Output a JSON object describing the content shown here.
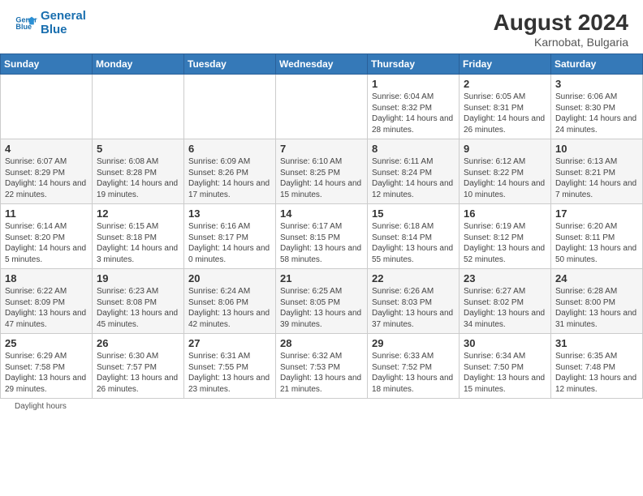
{
  "header": {
    "logo_line1": "General",
    "logo_line2": "Blue",
    "month_year": "August 2024",
    "location": "Karnobat, Bulgaria"
  },
  "days_of_week": [
    "Sunday",
    "Monday",
    "Tuesday",
    "Wednesday",
    "Thursday",
    "Friday",
    "Saturday"
  ],
  "weeks": [
    [
      {
        "day": "",
        "sunrise": "",
        "sunset": "",
        "daylight": ""
      },
      {
        "day": "",
        "sunrise": "",
        "sunset": "",
        "daylight": ""
      },
      {
        "day": "",
        "sunrise": "",
        "sunset": "",
        "daylight": ""
      },
      {
        "day": "",
        "sunrise": "",
        "sunset": "",
        "daylight": ""
      },
      {
        "day": "1",
        "sunrise": "Sunrise: 6:04 AM",
        "sunset": "Sunset: 8:32 PM",
        "daylight": "Daylight: 14 hours and 28 minutes."
      },
      {
        "day": "2",
        "sunrise": "Sunrise: 6:05 AM",
        "sunset": "Sunset: 8:31 PM",
        "daylight": "Daylight: 14 hours and 26 minutes."
      },
      {
        "day": "3",
        "sunrise": "Sunrise: 6:06 AM",
        "sunset": "Sunset: 8:30 PM",
        "daylight": "Daylight: 14 hours and 24 minutes."
      }
    ],
    [
      {
        "day": "4",
        "sunrise": "Sunrise: 6:07 AM",
        "sunset": "Sunset: 8:29 PM",
        "daylight": "Daylight: 14 hours and 22 minutes."
      },
      {
        "day": "5",
        "sunrise": "Sunrise: 6:08 AM",
        "sunset": "Sunset: 8:28 PM",
        "daylight": "Daylight: 14 hours and 19 minutes."
      },
      {
        "day": "6",
        "sunrise": "Sunrise: 6:09 AM",
        "sunset": "Sunset: 8:26 PM",
        "daylight": "Daylight: 14 hours and 17 minutes."
      },
      {
        "day": "7",
        "sunrise": "Sunrise: 6:10 AM",
        "sunset": "Sunset: 8:25 PM",
        "daylight": "Daylight: 14 hours and 15 minutes."
      },
      {
        "day": "8",
        "sunrise": "Sunrise: 6:11 AM",
        "sunset": "Sunset: 8:24 PM",
        "daylight": "Daylight: 14 hours and 12 minutes."
      },
      {
        "day": "9",
        "sunrise": "Sunrise: 6:12 AM",
        "sunset": "Sunset: 8:22 PM",
        "daylight": "Daylight: 14 hours and 10 minutes."
      },
      {
        "day": "10",
        "sunrise": "Sunrise: 6:13 AM",
        "sunset": "Sunset: 8:21 PM",
        "daylight": "Daylight: 14 hours and 7 minutes."
      }
    ],
    [
      {
        "day": "11",
        "sunrise": "Sunrise: 6:14 AM",
        "sunset": "Sunset: 8:20 PM",
        "daylight": "Daylight: 14 hours and 5 minutes."
      },
      {
        "day": "12",
        "sunrise": "Sunrise: 6:15 AM",
        "sunset": "Sunset: 8:18 PM",
        "daylight": "Daylight: 14 hours and 3 minutes."
      },
      {
        "day": "13",
        "sunrise": "Sunrise: 6:16 AM",
        "sunset": "Sunset: 8:17 PM",
        "daylight": "Daylight: 14 hours and 0 minutes."
      },
      {
        "day": "14",
        "sunrise": "Sunrise: 6:17 AM",
        "sunset": "Sunset: 8:15 PM",
        "daylight": "Daylight: 13 hours and 58 minutes."
      },
      {
        "day": "15",
        "sunrise": "Sunrise: 6:18 AM",
        "sunset": "Sunset: 8:14 PM",
        "daylight": "Daylight: 13 hours and 55 minutes."
      },
      {
        "day": "16",
        "sunrise": "Sunrise: 6:19 AM",
        "sunset": "Sunset: 8:12 PM",
        "daylight": "Daylight: 13 hours and 52 minutes."
      },
      {
        "day": "17",
        "sunrise": "Sunrise: 6:20 AM",
        "sunset": "Sunset: 8:11 PM",
        "daylight": "Daylight: 13 hours and 50 minutes."
      }
    ],
    [
      {
        "day": "18",
        "sunrise": "Sunrise: 6:22 AM",
        "sunset": "Sunset: 8:09 PM",
        "daylight": "Daylight: 13 hours and 47 minutes."
      },
      {
        "day": "19",
        "sunrise": "Sunrise: 6:23 AM",
        "sunset": "Sunset: 8:08 PM",
        "daylight": "Daylight: 13 hours and 45 minutes."
      },
      {
        "day": "20",
        "sunrise": "Sunrise: 6:24 AM",
        "sunset": "Sunset: 8:06 PM",
        "daylight": "Daylight: 13 hours and 42 minutes."
      },
      {
        "day": "21",
        "sunrise": "Sunrise: 6:25 AM",
        "sunset": "Sunset: 8:05 PM",
        "daylight": "Daylight: 13 hours and 39 minutes."
      },
      {
        "day": "22",
        "sunrise": "Sunrise: 6:26 AM",
        "sunset": "Sunset: 8:03 PM",
        "daylight": "Daylight: 13 hours and 37 minutes."
      },
      {
        "day": "23",
        "sunrise": "Sunrise: 6:27 AM",
        "sunset": "Sunset: 8:02 PM",
        "daylight": "Daylight: 13 hours and 34 minutes."
      },
      {
        "day": "24",
        "sunrise": "Sunrise: 6:28 AM",
        "sunset": "Sunset: 8:00 PM",
        "daylight": "Daylight: 13 hours and 31 minutes."
      }
    ],
    [
      {
        "day": "25",
        "sunrise": "Sunrise: 6:29 AM",
        "sunset": "Sunset: 7:58 PM",
        "daylight": "Daylight: 13 hours and 29 minutes."
      },
      {
        "day": "26",
        "sunrise": "Sunrise: 6:30 AM",
        "sunset": "Sunset: 7:57 PM",
        "daylight": "Daylight: 13 hours and 26 minutes."
      },
      {
        "day": "27",
        "sunrise": "Sunrise: 6:31 AM",
        "sunset": "Sunset: 7:55 PM",
        "daylight": "Daylight: 13 hours and 23 minutes."
      },
      {
        "day": "28",
        "sunrise": "Sunrise: 6:32 AM",
        "sunset": "Sunset: 7:53 PM",
        "daylight": "Daylight: 13 hours and 21 minutes."
      },
      {
        "day": "29",
        "sunrise": "Sunrise: 6:33 AM",
        "sunset": "Sunset: 7:52 PM",
        "daylight": "Daylight: 13 hours and 18 minutes."
      },
      {
        "day": "30",
        "sunrise": "Sunrise: 6:34 AM",
        "sunset": "Sunset: 7:50 PM",
        "daylight": "Daylight: 13 hours and 15 minutes."
      },
      {
        "day": "31",
        "sunrise": "Sunrise: 6:35 AM",
        "sunset": "Sunset: 7:48 PM",
        "daylight": "Daylight: 13 hours and 12 minutes."
      }
    ]
  ],
  "footer": {
    "note": "Daylight hours"
  }
}
